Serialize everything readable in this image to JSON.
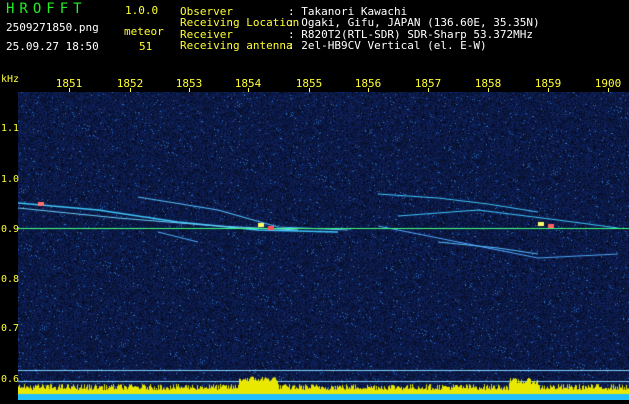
{
  "app": {
    "name": "HROFFT",
    "version": "1.0.0"
  },
  "file": {
    "name": "2509271850.png",
    "datetime": "25.09.27 18:50"
  },
  "meteor": {
    "label": "meteor",
    "count": "51"
  },
  "info": {
    "observer_label": "Observer",
    "observer_value": ": Takanori Kawachi",
    "location_label": "Receiving Location",
    "location_value": ": Ogaki, Gifu, JAPAN (136.60E, 35.35N)",
    "receiver_label": "Receiver",
    "receiver_value": ": R820T2(RTL-SDR) SDR-Sharp 53.372MHz",
    "antenna_label": "Receiving antenna",
    "antenna_value": ": 2el-HB9CV Vertical (el. E-W)"
  },
  "axis": {
    "unit": "kHz",
    "time_ticks": [
      "1851",
      "1852",
      "1853",
      "1854",
      "1855",
      "1856",
      "1857",
      "1858",
      "1859",
      "1900"
    ],
    "freq_ticks": [
      "1.1",
      "1.0",
      "0.9",
      "0.8",
      "0.7",
      "0.6"
    ]
  },
  "colors": {
    "accent_green": "#22ee22",
    "label_yellow": "#ffff33",
    "background": "#000000",
    "noise_blue": "#1a3a8a",
    "signal_cyan": "#3ec8ff"
  }
}
